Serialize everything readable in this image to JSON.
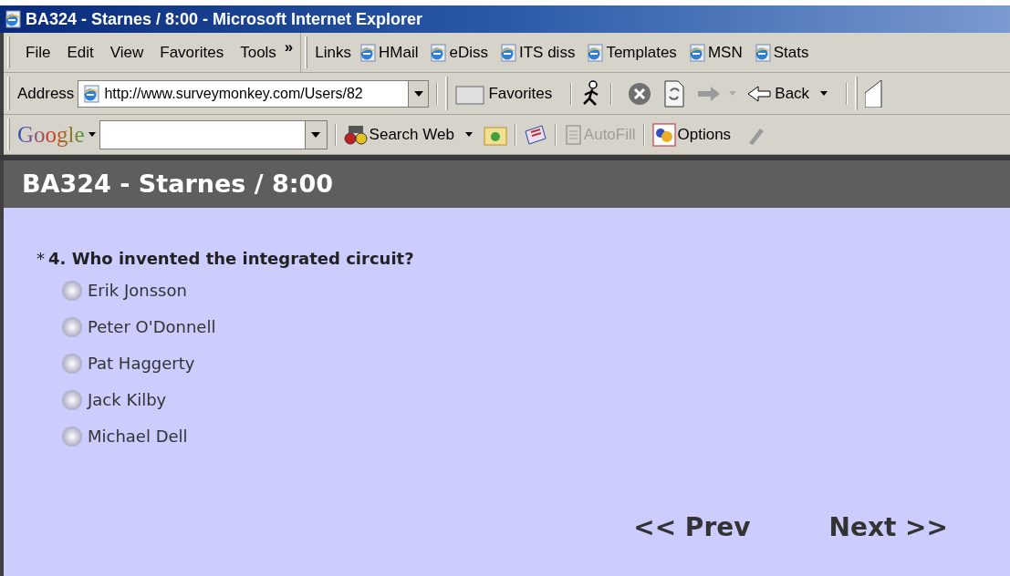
{
  "window": {
    "title": "BA324 - Starnes / 8:00 - Microsoft Internet Explorer"
  },
  "menu": [
    "File",
    "Edit",
    "View",
    "Favorites",
    "Tools"
  ],
  "menu_more": "»",
  "links": {
    "label": "Links",
    "items": [
      "HMail",
      "eDiss",
      "ITS diss",
      "Templates",
      "MSN",
      "Stats"
    ]
  },
  "address": {
    "label": "Address",
    "value": "http://www.surveymonkey.com/Users/82"
  },
  "nav": {
    "favorites": "Favorites",
    "back": "Back",
    "forward_disabled": true
  },
  "google_bar": {
    "logo": "Google",
    "search_label": "Search Web",
    "autofill": {
      "label": "AutoFill",
      "disabled": true
    },
    "options": "Options"
  },
  "page": {
    "header": "BA324 - Starnes / 8:00",
    "question": {
      "required_mark": "*",
      "text": "4. Who invented the integrated circuit?",
      "options": [
        {
          "label": "Erik Jonsson",
          "selected": false
        },
        {
          "label": "Peter O'Donnell",
          "selected": false
        },
        {
          "label": "Pat Haggerty",
          "selected": false
        },
        {
          "label": "Jack Kilby",
          "selected": false
        },
        {
          "label": "Michael Dell",
          "selected": false
        }
      ]
    },
    "buttons": {
      "prev": "<< Prev",
      "next": "Next >>"
    }
  }
}
